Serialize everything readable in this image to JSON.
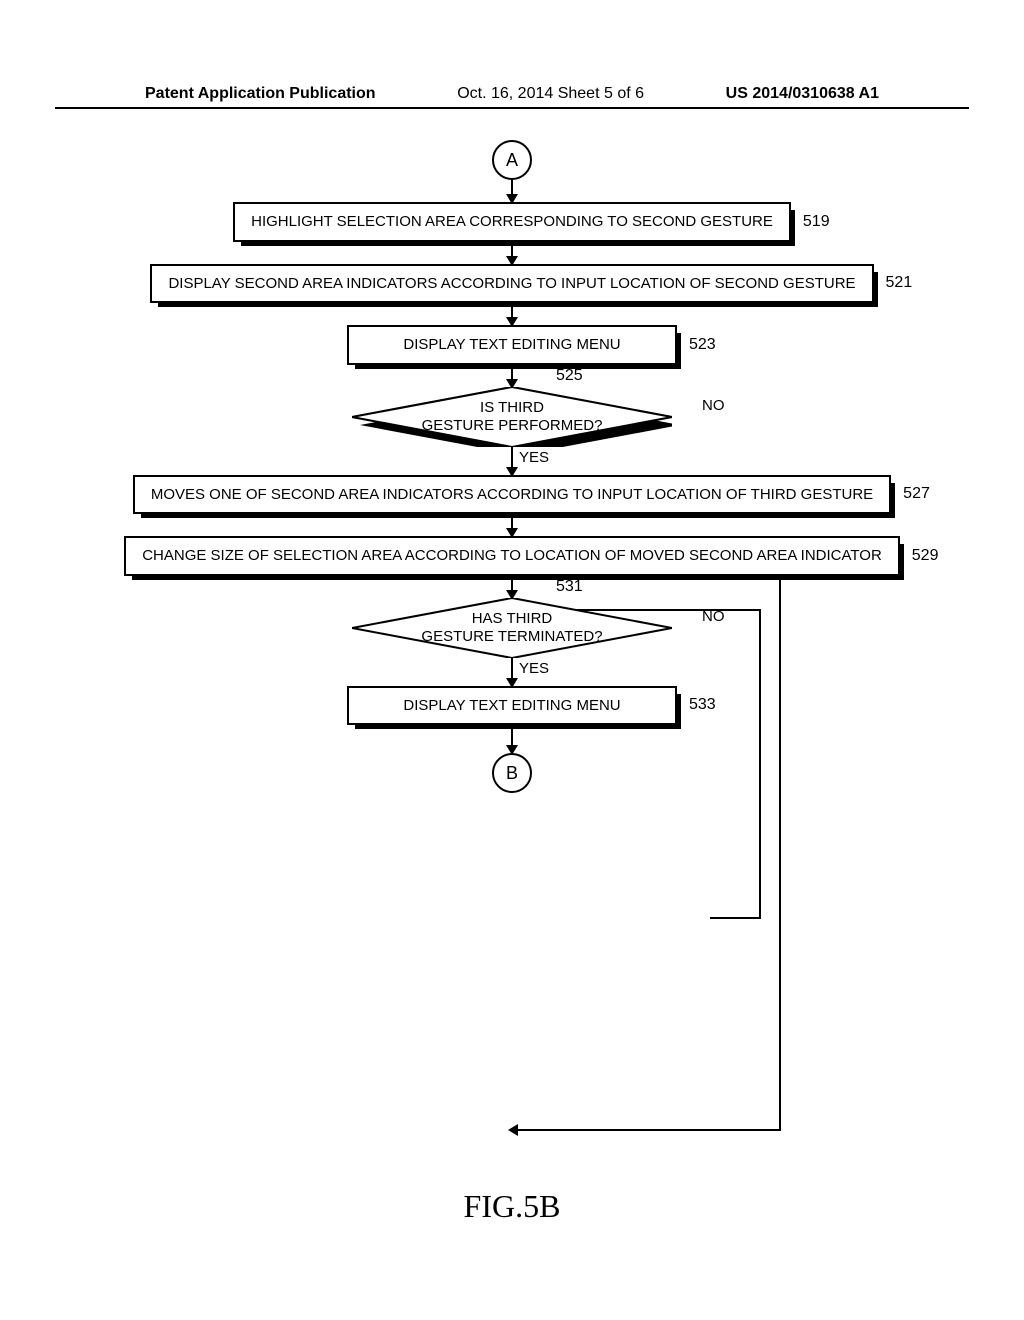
{
  "header": {
    "left": "Patent Application Publication",
    "center": "Oct. 16, 2014  Sheet 5 of 6",
    "right": "US 2014/0310638 A1"
  },
  "flowchart": {
    "connector_top": "A",
    "connector_bottom": "B",
    "box_519": "HIGHLIGHT SELECTION AREA CORRESPONDING TO SECOND GESTURE",
    "ref_519": "519",
    "box_521": "DISPLAY SECOND AREA INDICATORS ACCORDING TO INPUT LOCATION OF SECOND GESTURE",
    "ref_521": "521",
    "box_523": "DISPLAY TEXT EDITING MENU",
    "ref_523": "523",
    "decision_525": "IS THIRD\nGESTURE PERFORMED?",
    "ref_525": "525",
    "box_527": "MOVES ONE OF SECOND AREA INDICATORS ACCORDING TO INPUT LOCATION OF THIRD GESTURE",
    "ref_527": "527",
    "box_529": "CHANGE SIZE OF SELECTION AREA ACCORDING TO LOCATION OF MOVED SECOND AREA INDICATOR",
    "ref_529": "529",
    "decision_531": "HAS THIRD\nGESTURE TERMINATED?",
    "ref_531": "531",
    "box_533": "DISPLAY TEXT EDITING MENU",
    "ref_533": "533",
    "yes": "YES",
    "no": "NO"
  },
  "figure_label": "FIG.5B",
  "chart_data": {
    "type": "flowchart",
    "nodes": [
      {
        "id": "A",
        "type": "connector",
        "label": "A"
      },
      {
        "id": "519",
        "type": "process",
        "label": "HIGHLIGHT SELECTION AREA CORRESPONDING TO SECOND GESTURE"
      },
      {
        "id": "521",
        "type": "process",
        "label": "DISPLAY SECOND AREA INDICATORS ACCORDING TO INPUT LOCATION OF SECOND GESTURE"
      },
      {
        "id": "523",
        "type": "process",
        "label": "DISPLAY TEXT EDITING MENU"
      },
      {
        "id": "525",
        "type": "decision",
        "label": "IS THIRD GESTURE PERFORMED?"
      },
      {
        "id": "527",
        "type": "process",
        "label": "MOVES ONE OF SECOND AREA INDICATORS ACCORDING TO INPUT LOCATION OF THIRD GESTURE"
      },
      {
        "id": "529",
        "type": "process",
        "label": "CHANGE SIZE OF SELECTION AREA ACCORDING TO LOCATION OF MOVED SECOND AREA INDICATOR"
      },
      {
        "id": "531",
        "type": "decision",
        "label": "HAS THIRD GESTURE TERMINATED?"
      },
      {
        "id": "533",
        "type": "process",
        "label": "DISPLAY TEXT EDITING MENU"
      },
      {
        "id": "B",
        "type": "connector",
        "label": "B"
      }
    ],
    "edges": [
      {
        "from": "A",
        "to": "519"
      },
      {
        "from": "519",
        "to": "521"
      },
      {
        "from": "521",
        "to": "523"
      },
      {
        "from": "523",
        "to": "525"
      },
      {
        "from": "525",
        "to": "527",
        "label": "YES"
      },
      {
        "from": "525",
        "to": "B",
        "label": "NO"
      },
      {
        "from": "527",
        "to": "529"
      },
      {
        "from": "529",
        "to": "531"
      },
      {
        "from": "531",
        "to": "533",
        "label": "YES"
      },
      {
        "from": "531",
        "to": "527",
        "label": "NO"
      },
      {
        "from": "533",
        "to": "B"
      }
    ]
  }
}
